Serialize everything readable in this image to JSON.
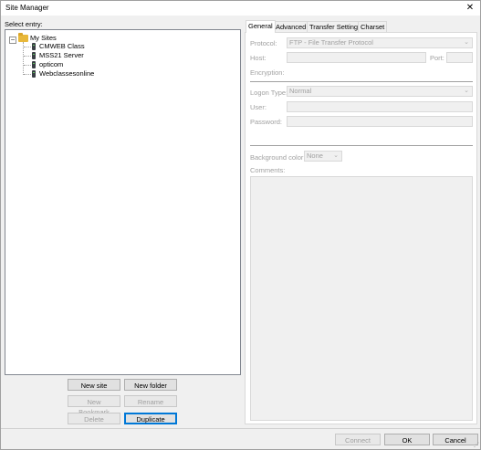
{
  "window": {
    "title": "Site Manager",
    "close_glyph": "✕"
  },
  "tree": {
    "label": "Select entry:",
    "root": {
      "label": "My Sites",
      "expander": "−"
    },
    "sites": [
      "CMWEB Class",
      "MSS21 Server",
      "opticom",
      "Webclassesonline"
    ]
  },
  "left_buttons": {
    "new_site": "New site",
    "new_folder": "New folder",
    "new_bookmark": "New Bookmark",
    "rename": "Rename",
    "delete": "Delete",
    "duplicate": "Duplicate"
  },
  "tabs": [
    "General",
    "Advanced",
    "Transfer Settings",
    "Charset"
  ],
  "general": {
    "protocol_label": "Protocol:",
    "protocol_value": "FTP - File Transfer Protocol",
    "host_label": "Host:",
    "host_value": "",
    "port_label": "Port:",
    "port_value": "",
    "encryption_label": "Encryption:",
    "logon_type_label": "Logon Type:",
    "logon_type_value": "Normal",
    "user_label": "User:",
    "user_value": "",
    "password_label": "Password:",
    "password_value": "",
    "bg_color_label": "Background color:",
    "bg_color_value": "None",
    "comments_label": "Comments:"
  },
  "bottom_buttons": {
    "connect": "Connect",
    "ok": "OK",
    "cancel": "Cancel"
  }
}
